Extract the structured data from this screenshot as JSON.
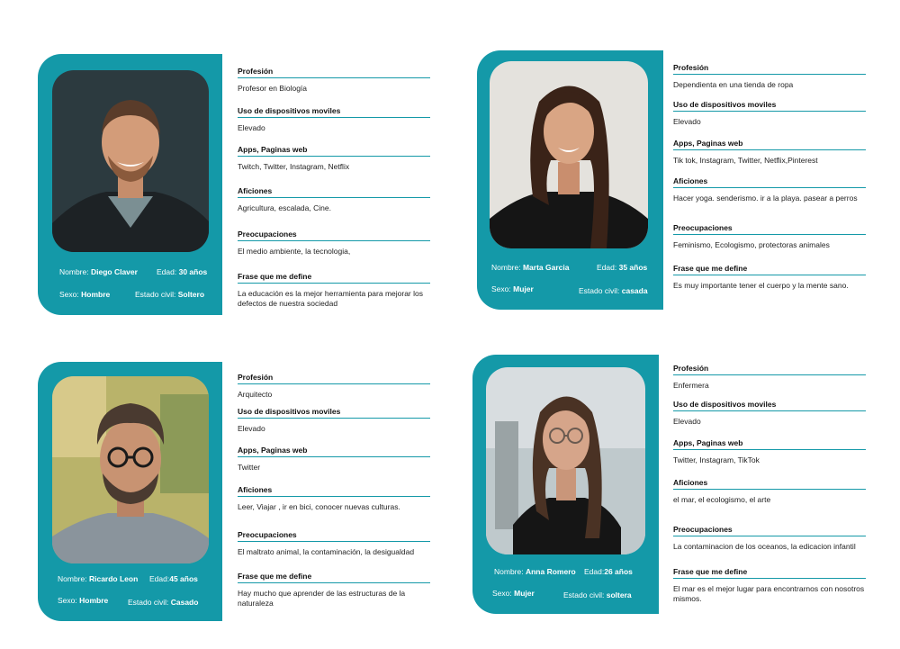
{
  "personas": [
    {
      "meta": {
        "nombre_label": "Nombre:",
        "nombre": "Diego Claver",
        "edad_label": "Edad:",
        "edad": "30 años",
        "sexo_label": "Sexo:",
        "sexo": "Hombre",
        "estado_label": "Estado civil:",
        "estado": "Soltero"
      },
      "sections": [
        {
          "label": "Profesión",
          "value": "Profesor en Biología"
        },
        {
          "label": "Uso de dispositivos moviles",
          "value": "Elevado"
        },
        {
          "label": "Apps, Paginas web",
          "value": "Twitch, Twitter, Instagram, Netflix"
        },
        {
          "label": "Aficiones",
          "value": "Agricultura, escalada, Cine."
        },
        {
          "label": "Preocupaciones",
          "value": "El medio ambiente, la tecnologia,"
        },
        {
          "label": "Frase que me define",
          "value": "La educación es la mejor herramienta para mejorar los defectos de nuestra sociedad"
        }
      ]
    },
    {
      "meta": {
        "nombre_label": "Nombre:",
        "nombre": "Marta Garcia",
        "edad_label": "Edad:",
        "edad": "35 años",
        "sexo_label": "Sexo:",
        "sexo": "Mujer",
        "estado_label": "Estado civil:",
        "estado": "casada"
      },
      "sections": [
        {
          "label": "Profesión",
          "value": "Dependienta en una tienda de ropa"
        },
        {
          "label": "Uso de dispositivos moviles",
          "value": "Elevado"
        },
        {
          "label": "Apps, Paginas web",
          "value": "Tik tok, Instagram, Twitter, Netflix,Pinterest"
        },
        {
          "label": "Aficiones",
          "value": "Hacer yoga. senderismo. ir a la playa. pasear a perros"
        },
        {
          "label": "Preocupaciones",
          "value": "Feminismo, Ecologismo, protectoras animales"
        },
        {
          "label": "Frase que me define",
          "value": "Es muy importante tener el cuerpo y la mente sano."
        }
      ]
    },
    {
      "meta": {
        "nombre_label": "Nombre:",
        "nombre": "Ricardo Leon",
        "edad_label": "Edad:",
        "edad": "45 años",
        "sexo_label": "Sexo:",
        "sexo": "Hombre",
        "estado_label": "Estado civil:",
        "estado": "Casado"
      },
      "sections": [
        {
          "label": "Profesión",
          "value": "Arquitecto"
        },
        {
          "label": "Uso de dispositivos moviles",
          "value": "Elevado"
        },
        {
          "label": "Apps, Paginas web",
          "value": "Twitter"
        },
        {
          "label": "Aficiones",
          "value": "Leer, Viajar , ir en bici, conocer nuevas culturas."
        },
        {
          "label": "Preocupaciones",
          "value": "El maltrato animal, la contaminación, la desigualdad"
        },
        {
          "label": "Frase que me define",
          "value": "Hay mucho que aprender de las estructuras de la naturaleza"
        }
      ]
    },
    {
      "meta": {
        "nombre_label": "Nombre:",
        "nombre": "Anna Romero",
        "edad_label": "Edad:",
        "edad": "26 años",
        "sexo_label": "Sexo:",
        "sexo": "Mujer",
        "estado_label": "Estado civil:",
        "estado": "soltera"
      },
      "sections": [
        {
          "label": "Profesión",
          "value": "Enfermera"
        },
        {
          "label": "Uso de dispositivos moviles",
          "value": "Elevado"
        },
        {
          "label": "Apps, Paginas web",
          "value": "Twitter, Instagram, TikTok"
        },
        {
          "label": "Aficiones",
          "value": "el mar, el ecologismo, el arte"
        },
        {
          "label": "Preocupaciones",
          "value": "La contaminacion de los oceanos, la edicacion infantil"
        },
        {
          "label": "Frase que me define",
          "value": "El mar es el mejor lugar para encontrarnos con nosotros mismos."
        }
      ]
    }
  ]
}
